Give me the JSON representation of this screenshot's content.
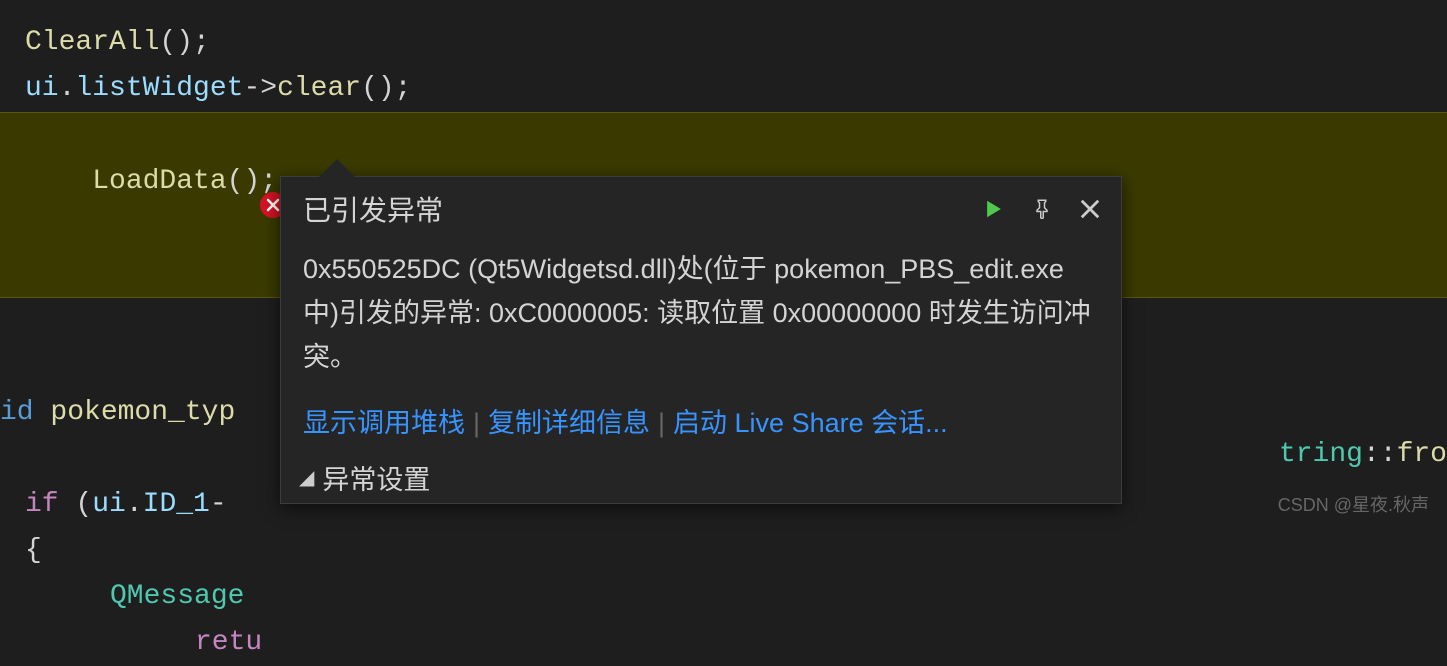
{
  "code": {
    "l1_fn": "ClearAll",
    "l1_rest": "();",
    "l2_obj": "ui",
    "l2_dot": ".",
    "l2_member": "listWidget",
    "l2_arrow": "->",
    "l2_fn": "clear",
    "l2_rest": "();",
    "l3_fn": "LoadData",
    "l3_rest": "();",
    "l5_kw": "id",
    "l5_sp": " ",
    "l5_fn": "pokemon_typ",
    "l7_kw": "if",
    "l7_head": " (",
    "l7_obj": "ui",
    "l7_dot": ".",
    "l7_member": "ID_1",
    "l7_dash": "-",
    "l8": "{",
    "l9_cls": "QMessage",
    "l10_kw": "retu",
    "right_cls": "tring",
    "right_sep": "::",
    "right_fn": "fro"
  },
  "popup": {
    "title": "已引发异常",
    "body": "0x550525DC (Qt5Widgetsd.dll)处(位于 pokemon_PBS_edit.exe 中)引发的异常: 0xC0000005: 读取位置 0x00000000 时发生访问冲突。",
    "links": {
      "callstack": "显示调用堆栈",
      "copy": "复制详细信息",
      "liveshare": "启动 Live Share 会话..."
    },
    "footer": "异常设置"
  },
  "watermark": "CSDN @星夜.秋声"
}
